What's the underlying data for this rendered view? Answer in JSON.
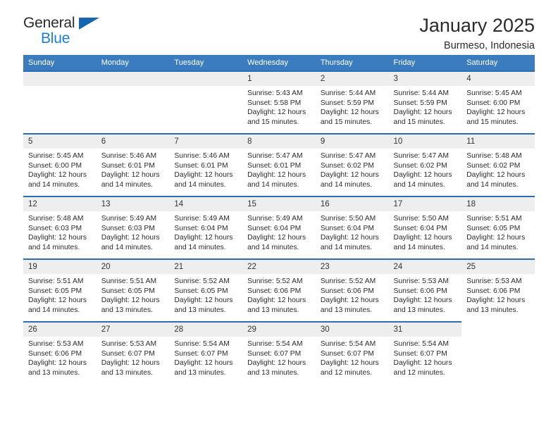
{
  "brand": {
    "name_part1": "General",
    "name_part2": "Blue",
    "accent_color": "#1b7fd4",
    "flag_color": "#1667b0"
  },
  "header": {
    "title": "January 2025",
    "subtitle": "Burmeso, Indonesia"
  },
  "theme": {
    "header_bar_color": "#3a7cbe",
    "cell_top_border_color": "#2a6db5",
    "daynum_band_color": "#eeeeee"
  },
  "columns": [
    "Sunday",
    "Monday",
    "Tuesday",
    "Wednesday",
    "Thursday",
    "Friday",
    "Saturday"
  ],
  "weeks": [
    [
      {
        "day": "",
        "empty": true
      },
      {
        "day": "",
        "empty": true
      },
      {
        "day": "",
        "empty": true
      },
      {
        "day": "1",
        "sunrise": "Sunrise: 5:43 AM",
        "sunset": "Sunset: 5:58 PM",
        "daylight": "Daylight: 12 hours and 15 minutes."
      },
      {
        "day": "2",
        "sunrise": "Sunrise: 5:44 AM",
        "sunset": "Sunset: 5:59 PM",
        "daylight": "Daylight: 12 hours and 15 minutes."
      },
      {
        "day": "3",
        "sunrise": "Sunrise: 5:44 AM",
        "sunset": "Sunset: 5:59 PM",
        "daylight": "Daylight: 12 hours and 15 minutes."
      },
      {
        "day": "4",
        "sunrise": "Sunrise: 5:45 AM",
        "sunset": "Sunset: 6:00 PM",
        "daylight": "Daylight: 12 hours and 15 minutes."
      }
    ],
    [
      {
        "day": "5",
        "sunrise": "Sunrise: 5:45 AM",
        "sunset": "Sunset: 6:00 PM",
        "daylight": "Daylight: 12 hours and 14 minutes."
      },
      {
        "day": "6",
        "sunrise": "Sunrise: 5:46 AM",
        "sunset": "Sunset: 6:01 PM",
        "daylight": "Daylight: 12 hours and 14 minutes."
      },
      {
        "day": "7",
        "sunrise": "Sunrise: 5:46 AM",
        "sunset": "Sunset: 6:01 PM",
        "daylight": "Daylight: 12 hours and 14 minutes."
      },
      {
        "day": "8",
        "sunrise": "Sunrise: 5:47 AM",
        "sunset": "Sunset: 6:01 PM",
        "daylight": "Daylight: 12 hours and 14 minutes."
      },
      {
        "day": "9",
        "sunrise": "Sunrise: 5:47 AM",
        "sunset": "Sunset: 6:02 PM",
        "daylight": "Daylight: 12 hours and 14 minutes."
      },
      {
        "day": "10",
        "sunrise": "Sunrise: 5:47 AM",
        "sunset": "Sunset: 6:02 PM",
        "daylight": "Daylight: 12 hours and 14 minutes."
      },
      {
        "day": "11",
        "sunrise": "Sunrise: 5:48 AM",
        "sunset": "Sunset: 6:02 PM",
        "daylight": "Daylight: 12 hours and 14 minutes."
      }
    ],
    [
      {
        "day": "12",
        "sunrise": "Sunrise: 5:48 AM",
        "sunset": "Sunset: 6:03 PM",
        "daylight": "Daylight: 12 hours and 14 minutes."
      },
      {
        "day": "13",
        "sunrise": "Sunrise: 5:49 AM",
        "sunset": "Sunset: 6:03 PM",
        "daylight": "Daylight: 12 hours and 14 minutes."
      },
      {
        "day": "14",
        "sunrise": "Sunrise: 5:49 AM",
        "sunset": "Sunset: 6:04 PM",
        "daylight": "Daylight: 12 hours and 14 minutes."
      },
      {
        "day": "15",
        "sunrise": "Sunrise: 5:49 AM",
        "sunset": "Sunset: 6:04 PM",
        "daylight": "Daylight: 12 hours and 14 minutes."
      },
      {
        "day": "16",
        "sunrise": "Sunrise: 5:50 AM",
        "sunset": "Sunset: 6:04 PM",
        "daylight": "Daylight: 12 hours and 14 minutes."
      },
      {
        "day": "17",
        "sunrise": "Sunrise: 5:50 AM",
        "sunset": "Sunset: 6:04 PM",
        "daylight": "Daylight: 12 hours and 14 minutes."
      },
      {
        "day": "18",
        "sunrise": "Sunrise: 5:51 AM",
        "sunset": "Sunset: 6:05 PM",
        "daylight": "Daylight: 12 hours and 14 minutes."
      }
    ],
    [
      {
        "day": "19",
        "sunrise": "Sunrise: 5:51 AM",
        "sunset": "Sunset: 6:05 PM",
        "daylight": "Daylight: 12 hours and 14 minutes."
      },
      {
        "day": "20",
        "sunrise": "Sunrise: 5:51 AM",
        "sunset": "Sunset: 6:05 PM",
        "daylight": "Daylight: 12 hours and 13 minutes."
      },
      {
        "day": "21",
        "sunrise": "Sunrise: 5:52 AM",
        "sunset": "Sunset: 6:05 PM",
        "daylight": "Daylight: 12 hours and 13 minutes."
      },
      {
        "day": "22",
        "sunrise": "Sunrise: 5:52 AM",
        "sunset": "Sunset: 6:06 PM",
        "daylight": "Daylight: 12 hours and 13 minutes."
      },
      {
        "day": "23",
        "sunrise": "Sunrise: 5:52 AM",
        "sunset": "Sunset: 6:06 PM",
        "daylight": "Daylight: 12 hours and 13 minutes."
      },
      {
        "day": "24",
        "sunrise": "Sunrise: 5:53 AM",
        "sunset": "Sunset: 6:06 PM",
        "daylight": "Daylight: 12 hours and 13 minutes."
      },
      {
        "day": "25",
        "sunrise": "Sunrise: 5:53 AM",
        "sunset": "Sunset: 6:06 PM",
        "daylight": "Daylight: 12 hours and 13 minutes."
      }
    ],
    [
      {
        "day": "26",
        "sunrise": "Sunrise: 5:53 AM",
        "sunset": "Sunset: 6:06 PM",
        "daylight": "Daylight: 12 hours and 13 minutes."
      },
      {
        "day": "27",
        "sunrise": "Sunrise: 5:53 AM",
        "sunset": "Sunset: 6:07 PM",
        "daylight": "Daylight: 12 hours and 13 minutes."
      },
      {
        "day": "28",
        "sunrise": "Sunrise: 5:54 AM",
        "sunset": "Sunset: 6:07 PM",
        "daylight": "Daylight: 12 hours and 13 minutes."
      },
      {
        "day": "29",
        "sunrise": "Sunrise: 5:54 AM",
        "sunset": "Sunset: 6:07 PM",
        "daylight": "Daylight: 12 hours and 13 minutes."
      },
      {
        "day": "30",
        "sunrise": "Sunrise: 5:54 AM",
        "sunset": "Sunset: 6:07 PM",
        "daylight": "Daylight: 12 hours and 12 minutes."
      },
      {
        "day": "31",
        "sunrise": "Sunrise: 5:54 AM",
        "sunset": "Sunset: 6:07 PM",
        "daylight": "Daylight: 12 hours and 12 minutes."
      },
      {
        "day": "",
        "empty": true,
        "blank": true
      }
    ]
  ]
}
